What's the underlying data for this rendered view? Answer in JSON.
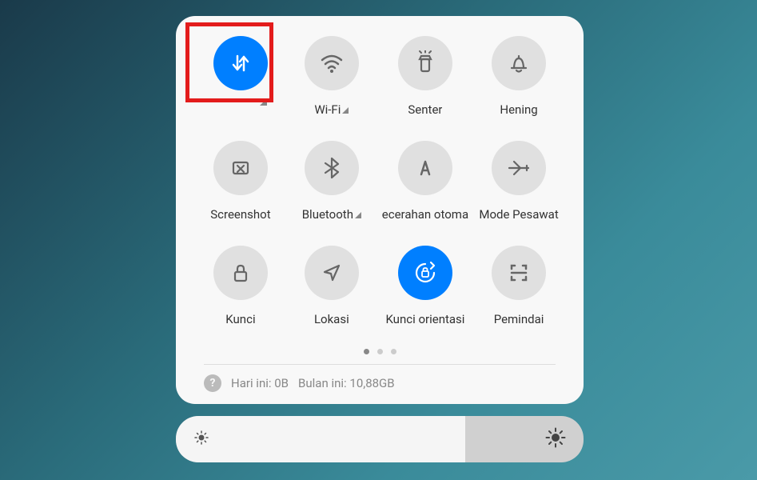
{
  "tiles": [
    {
      "label": "",
      "active": true,
      "icon": "mobile-data"
    },
    {
      "label": "Wi-Fi",
      "active": false,
      "icon": "wifi",
      "hasLabelTri": true
    },
    {
      "label": "Senter",
      "active": false,
      "icon": "flashlight"
    },
    {
      "label": "Hening",
      "active": false,
      "icon": "bell"
    },
    {
      "label": "Screenshot",
      "active": false,
      "icon": "screenshot"
    },
    {
      "label": "Bluetooth",
      "active": false,
      "icon": "bluetooth",
      "hasLabelTri": true
    },
    {
      "label": "ecerahan otoma",
      "active": false,
      "icon": "auto-bright"
    },
    {
      "label": "Mode Pesawat",
      "active": false,
      "icon": "airplane"
    },
    {
      "label": "Kunci",
      "active": false,
      "icon": "lock"
    },
    {
      "label": "Lokasi",
      "active": false,
      "icon": "location"
    },
    {
      "label": "Kunci orientasi",
      "active": true,
      "icon": "orientation-lock"
    },
    {
      "label": "Pemindai",
      "active": false,
      "icon": "scanner"
    }
  ],
  "cornerTriIndex": 0,
  "usage": {
    "today": "Hari ini: 0B",
    "month": "Bulan ini: 10,88GB"
  },
  "pagination": {
    "count": 3,
    "active": 0
  }
}
